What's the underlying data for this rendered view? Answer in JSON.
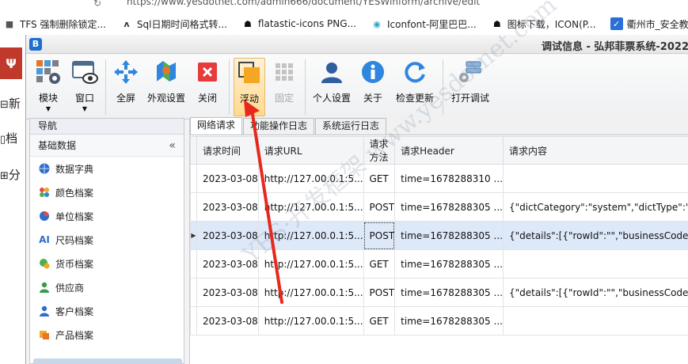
{
  "browser": {
    "url": "https://www.yesdotnet.com/admin666/document/YESWinform/archive/edit",
    "bookmarks": [
      {
        "icon": "tfs-icon",
        "label": "TFS 强制删除锁定..."
      },
      {
        "icon": "sql-icon",
        "label": "Sql日期时间格式转..."
      },
      {
        "icon": "flatastic-icon",
        "label": "flatastic-icons PNG..."
      },
      {
        "icon": "iconfont-icon",
        "label": "Iconfont-阿里巴巴..."
      },
      {
        "icon": "icon-download-icon",
        "label": "图标下载，ICON(P..."
      },
      {
        "icon": "mail-icon",
        "label": "衢州市_安全教育平台"
      }
    ]
  },
  "bg_app": {
    "items": [
      "新",
      "档",
      "分"
    ]
  },
  "window": {
    "title": "调试信息 - 弘邦菲票系统-2022",
    "app_icon_letter": "B"
  },
  "ribbon": {
    "buttons": [
      {
        "label": "模块",
        "icon": "modules-icon",
        "dropdown": true
      },
      {
        "label": "窗口",
        "icon": "window-icon",
        "dropdown": true
      },
      {
        "label": "全屏",
        "icon": "fullscreen-icon"
      },
      {
        "label": "外观设置",
        "icon": "appearance-icon"
      },
      {
        "label": "关闭",
        "icon": "close-icon"
      },
      {
        "label": "浮动",
        "icon": "float-icon"
      },
      {
        "label": "固定",
        "icon": "pin-icon",
        "disabled": true
      },
      {
        "label": "个人设置",
        "icon": "user-icon"
      },
      {
        "label": "关于",
        "icon": "info-icon"
      },
      {
        "label": "检查更新",
        "icon": "refresh-icon"
      },
      {
        "label": "打开调试",
        "icon": "debug-icon"
      }
    ]
  },
  "nav": {
    "header": "导航",
    "group": "基础数据",
    "collapse_glyph": "«",
    "items": [
      {
        "label": "数据字典",
        "icon": "globe-icon"
      },
      {
        "label": "颜色档案",
        "icon": "palette-icon"
      },
      {
        "label": "单位档案",
        "icon": "pie-icon"
      },
      {
        "label": "尺码档案",
        "icon": "ai-icon"
      },
      {
        "label": "货币档案",
        "icon": "coin-icon"
      },
      {
        "label": "供应商",
        "icon": "supplier-icon"
      },
      {
        "label": "客户档案",
        "icon": "customer-icon"
      },
      {
        "label": "产品档案",
        "icon": "product-icon"
      }
    ]
  },
  "tabs": [
    {
      "label": "网络请求",
      "active": true
    },
    {
      "label": "功能操作日志",
      "active": false
    },
    {
      "label": "系统运行日志",
      "active": false
    }
  ],
  "grid": {
    "columns": [
      "请求时间",
      "请求URL",
      "请求方法",
      "请求Header",
      "请求内容"
    ],
    "rows": [
      [
        "2023-03-08",
        "http://127.00.0.1:5...",
        "GET",
        "time=1678288310 ...",
        ""
      ],
      [
        "2023-03-08",
        "http://127.00.0.1:5...",
        "POST",
        "time=1678288305 ...",
        "{\"dictCategory\":\"system\",\"dictType\":\"B"
      ],
      [
        "2023-03-08",
        "http://127.00.0.1:5...",
        "POST",
        "time=1678288305 ...",
        "{\"details\":[{\"rowId\":\"\",\"businessCode\":"
      ],
      [
        "2023-03-08",
        "http://127.00.0.1:5...",
        "GET",
        "time=1678288305 ...",
        ""
      ],
      [
        "2023-03-08",
        "http://127.00.0.1:5...",
        "POST",
        "time=1678288305 ...",
        "{\"details\":[{\"rowId\":\"\",\"businessCode\":"
      ],
      [
        "2023-03-08",
        "http://127.00.0.1:5...",
        "GET",
        "time=1678288305 ...",
        ""
      ]
    ],
    "selected_row": 2,
    "row_indicator": "▶"
  },
  "watermark": "YES·开发框架 www.yesdotnet.com",
  "colors": {
    "accent": "#1e6fd0",
    "selection": "#dde9f9",
    "float_orange": "#f5a623",
    "arrow_red": "#e8281e"
  }
}
